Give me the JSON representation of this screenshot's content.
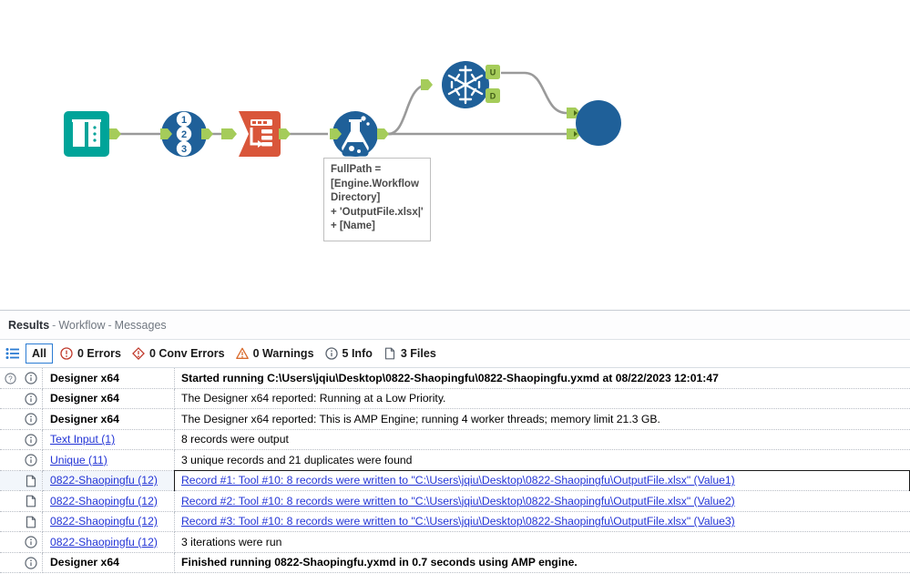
{
  "workflow": {
    "annotation_text": "FullPath =\n[Engine.Workflow\nDirectory]\n+ 'OutputFile.xlsx|'\n+ [Name]",
    "tools": [
      {
        "id": "text-input",
        "label": "Text Input",
        "icon": "book-icon",
        "color": "#00a499"
      },
      {
        "id": "record-id",
        "label": "Record ID",
        "icon": "numbers-123-icon",
        "color": "#1f6099"
      },
      {
        "id": "formula",
        "label": "Formula",
        "icon": "formula-icon",
        "color": "#d9563a"
      },
      {
        "id": "multi-field-formula",
        "label": "Multi-Field Formula",
        "icon": "flask-icon",
        "color": "#1f6099"
      },
      {
        "id": "unique",
        "label": "Unique",
        "icon": "snowflake-icon",
        "color": "#1f6099"
      },
      {
        "id": "union",
        "label": "Union",
        "icon": "circle-icon",
        "color": "#1f6099"
      }
    ],
    "anchors": {
      "unique_unique": "U",
      "unique_duplicate": "D",
      "union_input": "⌐"
    },
    "colors": {
      "anchor": "#a5cc5a",
      "connector": "#9a9a9a",
      "blue": "#1f6099",
      "teal": "#00a499",
      "red": "#d9563a"
    }
  },
  "results": {
    "header": {
      "title": "Results",
      "sep1": "-",
      "crumb1": "Workflow",
      "sep2": "-",
      "crumb2": "Messages"
    },
    "filters": [
      {
        "name": "all",
        "label": "All",
        "icon": "",
        "selected": true
      },
      {
        "name": "errors",
        "label": "0 Errors",
        "icon": "error-icon",
        "selected": false
      },
      {
        "name": "conv-errors",
        "label": "0 Conv Errors",
        "icon": "conv-error-icon",
        "selected": false
      },
      {
        "name": "warnings",
        "label": "0 Warnings",
        "icon": "warning-icon",
        "selected": false
      },
      {
        "name": "info",
        "label": "5 Info",
        "icon": "info-icon",
        "selected": false
      },
      {
        "name": "files",
        "label": "3 Files",
        "icon": "file-icon",
        "selected": false
      }
    ],
    "rows": [
      {
        "icon": "info-icon",
        "help": true,
        "tool": "Designer x64",
        "tool_link": false,
        "message": "Started running C:\\Users\\jqiu\\Desktop\\0822-Shaopingfu\\0822-Shaopingfu.yxmd at 08/22/2023 12:01:47",
        "msg_bold": true,
        "msg_link": false,
        "selected": false
      },
      {
        "icon": "info-icon",
        "help": false,
        "tool": "Designer x64",
        "tool_link": false,
        "message": "The Designer x64 reported: Running at a Low Priority.",
        "msg_bold": false,
        "msg_link": false,
        "selected": false
      },
      {
        "icon": "info-icon",
        "help": false,
        "tool": "Designer x64",
        "tool_link": false,
        "message": "The Designer x64 reported: This is AMP Engine; running 4 worker threads; memory limit 21.3 GB.",
        "msg_bold": false,
        "msg_link": false,
        "selected": false
      },
      {
        "icon": "info-icon",
        "help": false,
        "tool": "Text Input (1)",
        "tool_link": true,
        "message": "8 records were output",
        "msg_bold": false,
        "msg_link": false,
        "selected": false
      },
      {
        "icon": "info-icon",
        "help": false,
        "tool": "Unique (11)",
        "tool_link": true,
        "message": "3 unique records and 21 duplicates were found",
        "msg_bold": false,
        "msg_link": false,
        "selected": false
      },
      {
        "icon": "file-icon",
        "help": false,
        "tool": "0822-Shaopingfu (12)",
        "tool_link": true,
        "message": "Record #1: Tool #10: 8 records were written to \"C:\\Users\\jqiu\\Desktop\\0822-Shaopingfu\\OutputFile.xlsx\" (Value1)",
        "msg_bold": false,
        "msg_link": true,
        "selected": true
      },
      {
        "icon": "file-icon",
        "help": false,
        "tool": "0822-Shaopingfu (12)",
        "tool_link": true,
        "message": "Record #2: Tool #10: 8 records were written to \"C:\\Users\\jqiu\\Desktop\\0822-Shaopingfu\\OutputFile.xlsx\" (Value2)",
        "msg_bold": false,
        "msg_link": true,
        "selected": false
      },
      {
        "icon": "file-icon",
        "help": false,
        "tool": "0822-Shaopingfu (12)",
        "tool_link": true,
        "message": "Record #3: Tool #10: 8 records were written to \"C:\\Users\\jqiu\\Desktop\\0822-Shaopingfu\\OutputFile.xlsx\" (Value3)",
        "msg_bold": false,
        "msg_link": true,
        "selected": false
      },
      {
        "icon": "info-icon",
        "help": false,
        "tool": "0822-Shaopingfu (12)",
        "tool_link": true,
        "message": "3 iterations were run",
        "msg_bold": false,
        "msg_link": false,
        "selected": false
      },
      {
        "icon": "info-icon",
        "help": false,
        "tool": "Designer x64",
        "tool_link": false,
        "message": "Finished running 0822-Shaopingfu.yxmd in 0.7 seconds using AMP engine.",
        "msg_bold": true,
        "msg_link": false,
        "selected": false
      }
    ]
  }
}
